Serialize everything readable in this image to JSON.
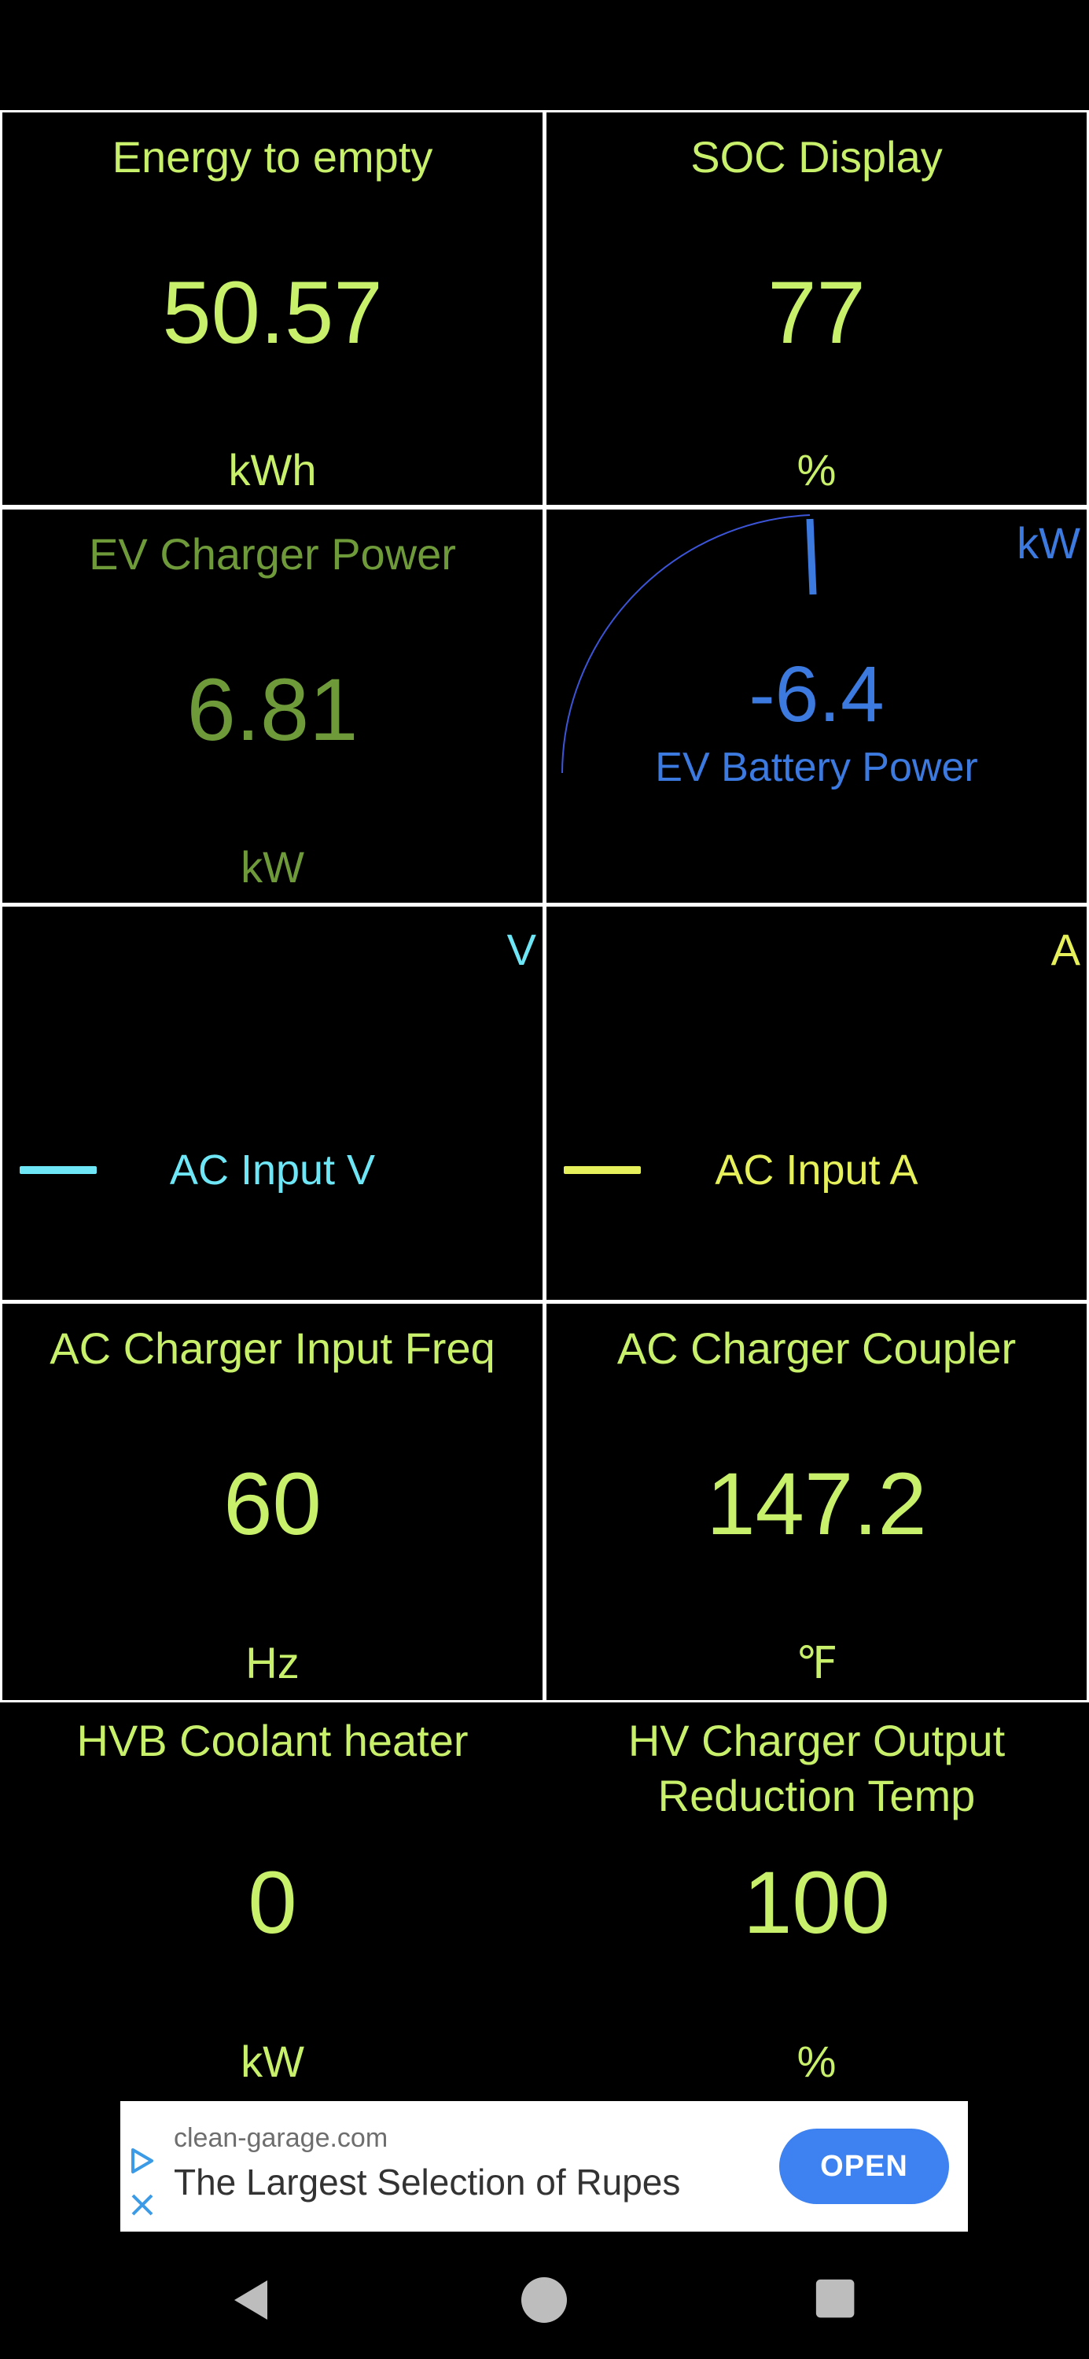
{
  "tiles": {
    "energy": {
      "label": "Energy to empty",
      "value": "50.57",
      "unit": "kWh"
    },
    "soc": {
      "label": "SOC Display",
      "value": "77",
      "unit": "%"
    },
    "charger_power": {
      "label": "EV Charger Power",
      "value": "6.81",
      "unit": "kW"
    },
    "battery_power": {
      "label": "EV Battery Power",
      "value": "-6.4",
      "unit": "kW"
    },
    "ac_input_v": {
      "label": "AC Input V",
      "unit": "V"
    },
    "ac_input_a": {
      "label": "AC Input A",
      "unit": "A"
    },
    "freq": {
      "label": "AC Charger Input Freq",
      "value": "60",
      "unit": "Hz"
    },
    "coupler": {
      "label": "AC Charger Coupler",
      "value": "147.2",
      "unit": "℉"
    },
    "hvb_heater": {
      "label": "HVB Coolant heater",
      "value": "0",
      "unit": "kW"
    },
    "hv_reduction": {
      "label_line1": "HV Charger Output",
      "label_line2": "Reduction Temp",
      "value": "100",
      "unit": "%"
    }
  },
  "ad": {
    "domain": "clean-garage.com",
    "title": "The Largest Selection of Rupes",
    "button": "OPEN"
  },
  "colors": {
    "primary": "#c8f06a",
    "green": "#6f9a3a",
    "blue": "#3c7ae0",
    "cyan": "#6ee6f6",
    "yellow": "#e6f05a",
    "border": "#ffffff"
  },
  "icons": [
    "adchoices-icon",
    "close-icon",
    "back-icon",
    "home-icon",
    "recents-icon"
  ]
}
